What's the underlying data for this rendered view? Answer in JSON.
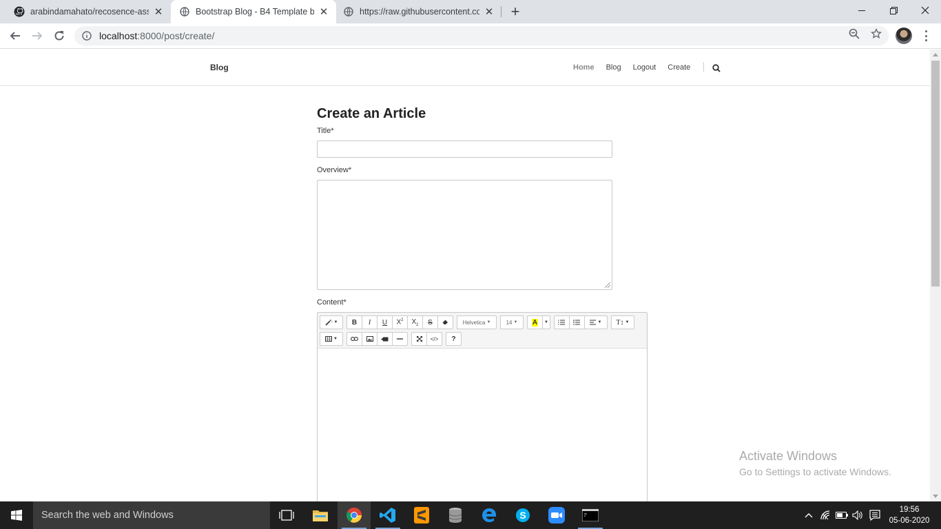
{
  "browser": {
    "tabs": [
      {
        "title": "arabindamahato/recosence-assig",
        "active": false
      },
      {
        "title": "Bootstrap Blog - B4 Template by",
        "active": true
      },
      {
        "title": "https://raw.githubusercontent.co",
        "active": false
      }
    ],
    "url_host": "localhost",
    "url_path": ":8000/post/create/"
  },
  "site": {
    "brand": "Blog",
    "nav": [
      "Home",
      "Blog",
      "Logout",
      "Create"
    ]
  },
  "form": {
    "heading": "Create an Article",
    "title_label": "Title*",
    "title_value": "",
    "overview_label": "Overview*",
    "overview_value": "",
    "content_label": "Content*",
    "font_family": "Helvetica",
    "font_size": "14",
    "help_label": "?"
  },
  "watermark": {
    "line1": "Activate Windows",
    "line2": "Go to Settings to activate Windows."
  },
  "taskbar": {
    "search_placeholder": "Search the web and Windows",
    "time": "19:56",
    "date": "05-06-2020"
  },
  "colors": {
    "highlight_yellow": "#ffff00",
    "taskbar_bg": "#1f1f1f"
  }
}
